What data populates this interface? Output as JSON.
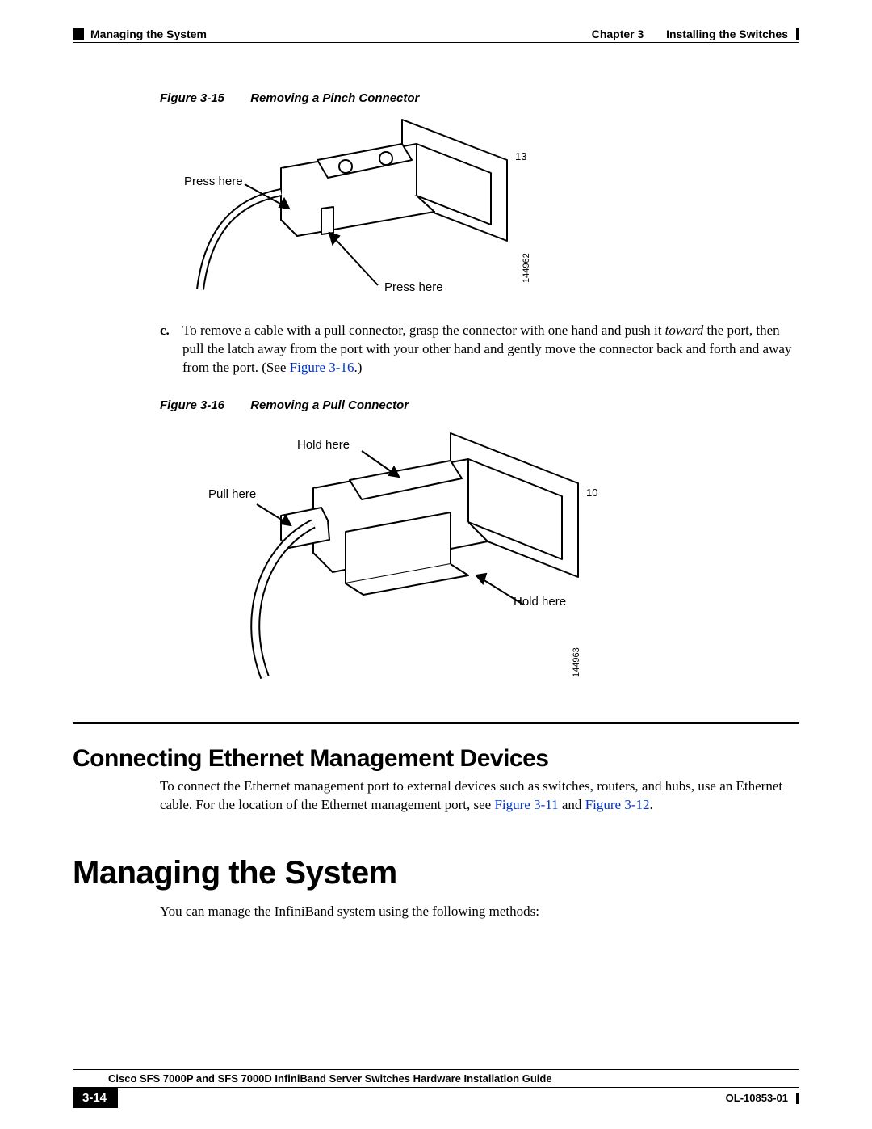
{
  "header": {
    "chapter": "Chapter 3",
    "chapter_title": "Installing the Switches",
    "section": "Managing the System"
  },
  "figure15": {
    "label": "Figure 3-15",
    "title": "Removing a Pinch Connector",
    "callout_press_here_1": "Press here",
    "callout_press_here_2": "Press here",
    "port_mark": "13",
    "image_id": "144962"
  },
  "step_c": {
    "marker": "c.",
    "text_before_italic": "To remove a cable with a pull connector, grasp the connector with one hand and push it ",
    "italic_word": "toward",
    "text_after_italic": " the port, then pull the latch away from the port with your other hand and gently move the connector back and forth and away from the port. (See ",
    "xref": "Figure 3-16",
    "text_close": ".)"
  },
  "figure16": {
    "label": "Figure 3-16",
    "title": "Removing a Pull Connector",
    "callout_hold_here_1": "Hold here",
    "callout_pull_here": "Pull here",
    "callout_hold_here_2": "Hold here",
    "port_mark": "10",
    "image_id": "144963"
  },
  "section2": {
    "title": "Connecting Ethernet Management Devices",
    "body_before_x1": "To connect the Ethernet management port to external devices such as switches, routers, and hubs, use an Ethernet cable. For the location of the Ethernet management port, see ",
    "xref1": "Figure 3-11",
    "and": " and ",
    "xref2": "Figure 3-12",
    "body_close": "."
  },
  "section3": {
    "title": "Managing the System",
    "body": "You can manage the InfiniBand system using the following methods:"
  },
  "footer": {
    "guide_title": "Cisco SFS 7000P and SFS 7000D InfiniBand Server Switches Hardware Installation Guide",
    "page_number": "3-14",
    "doc_id": "OL-10853-01"
  }
}
